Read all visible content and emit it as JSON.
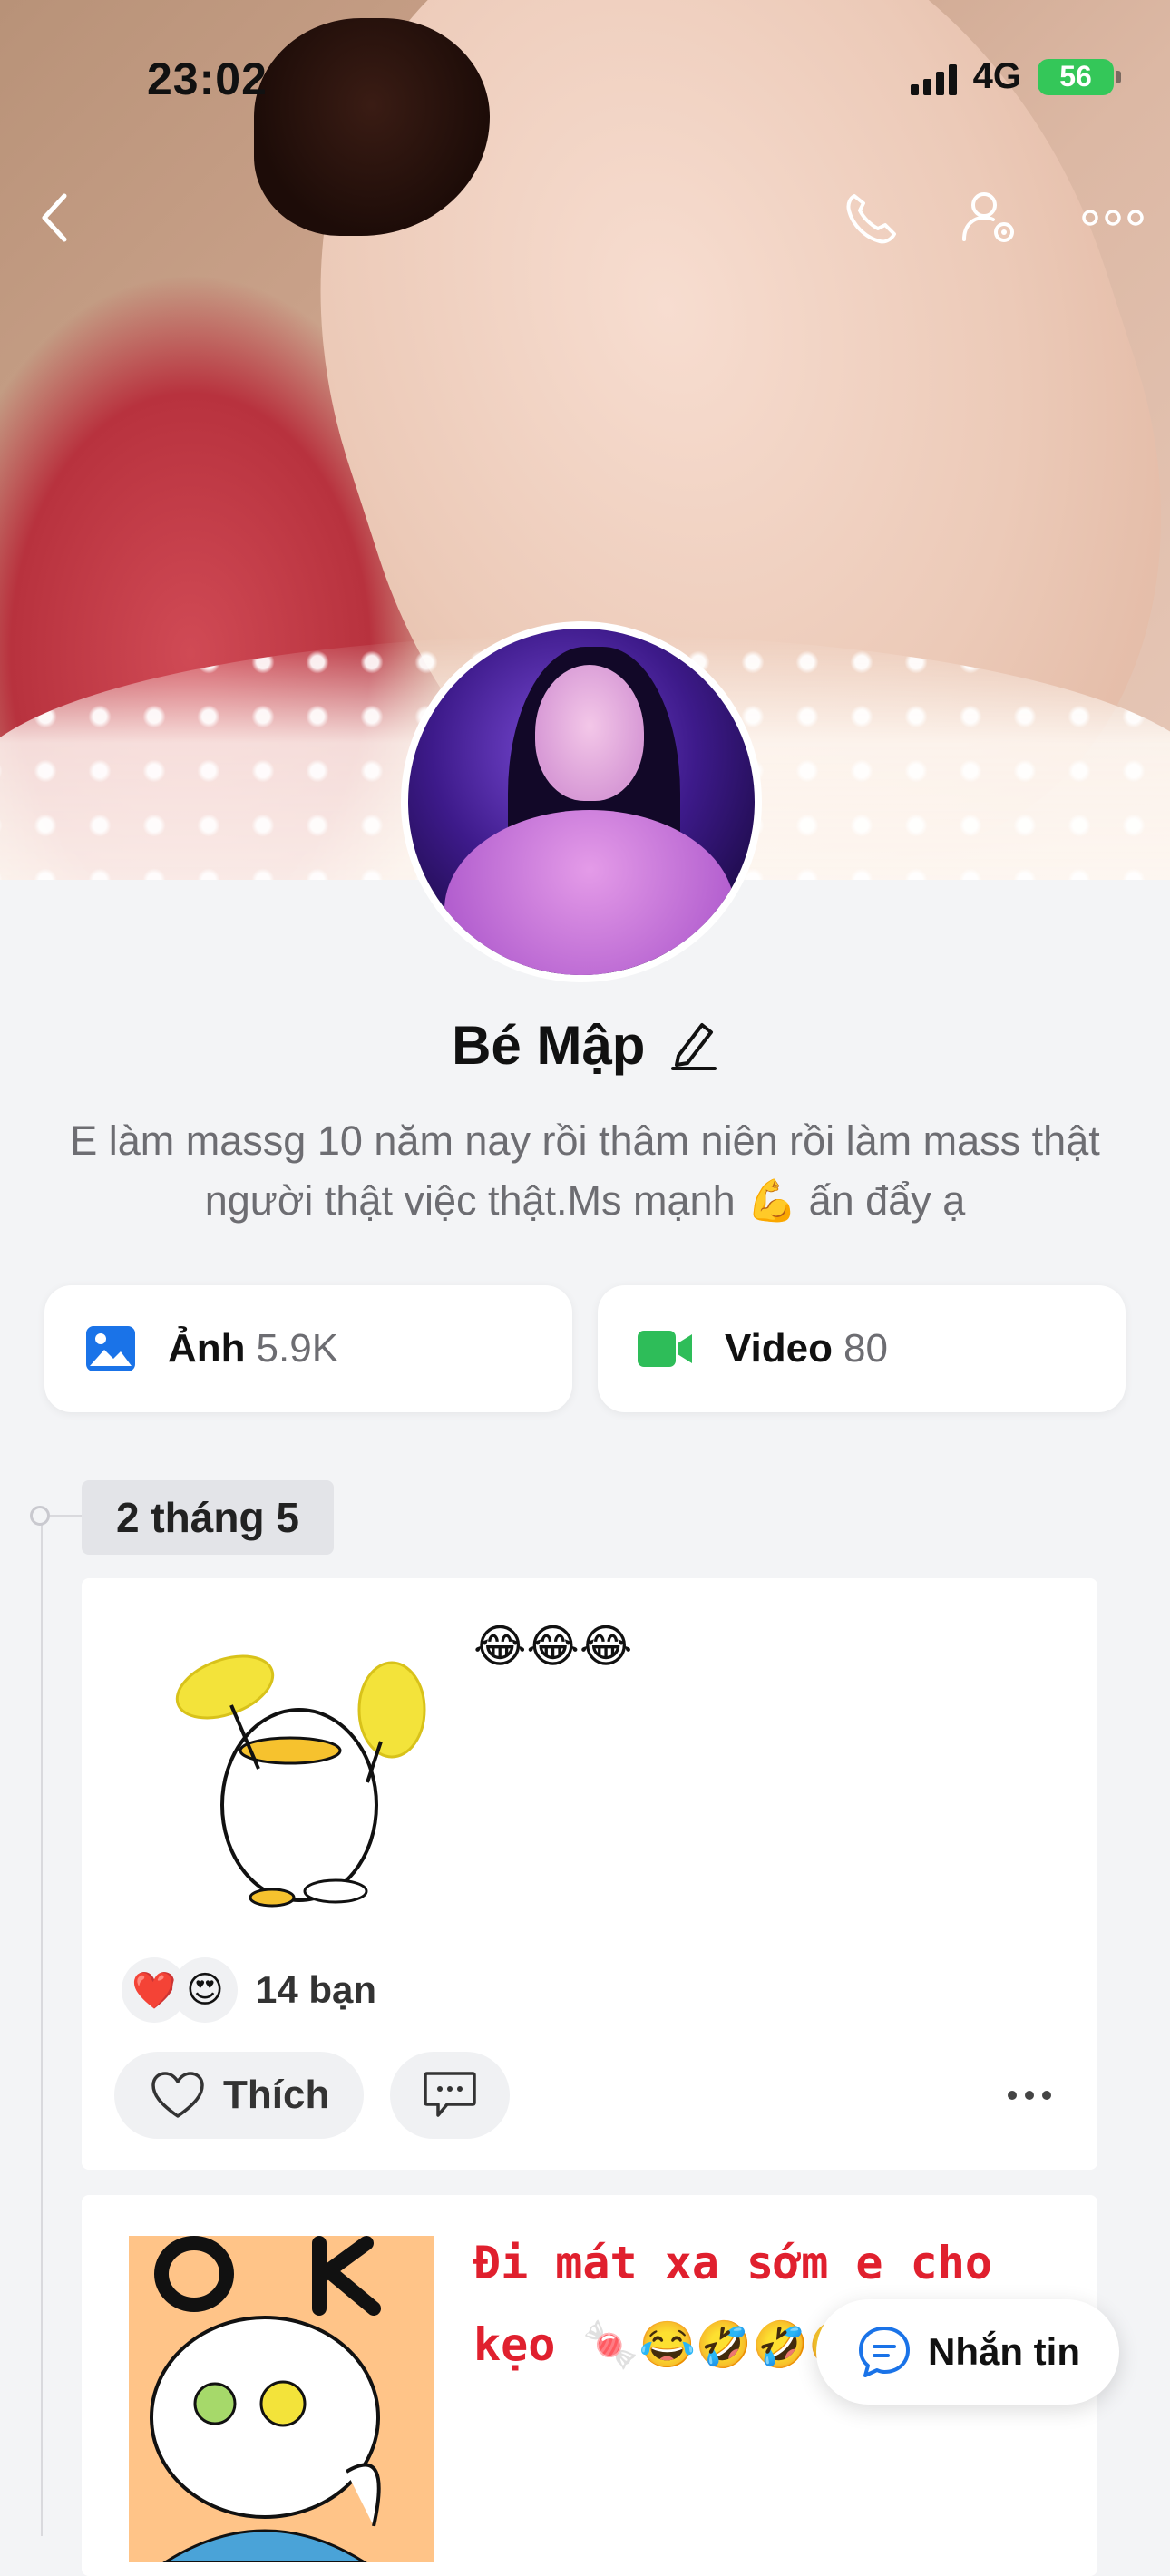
{
  "status_bar": {
    "time": "23:02",
    "network": "4G",
    "battery": "56"
  },
  "nav": {
    "icons": [
      "back-icon",
      "phone-icon",
      "user-settings-icon",
      "more-icon"
    ]
  },
  "profile": {
    "name": "Bé Mập",
    "bio": "E làm massg 10 năm nay rồi thâm niên rồi làm mass thật người thật việc thật.Ms mạnh 💪 ấn đẩy ạ"
  },
  "media": {
    "photos_label": "Ảnh",
    "photos_count": "5.9K",
    "video_label": "Video",
    "video_count": "80"
  },
  "timeline": {
    "date": "2 tháng 5",
    "posts": [
      {
        "text": "😂😂😂",
        "reaction_emojis": [
          "❤️",
          "😍"
        ],
        "reaction_count": "14 bạn",
        "like_label": "Thích"
      },
      {
        "text": "Đi mát xa sớm e cho kẹo 🍬😂🤣🤣🤣"
      }
    ]
  },
  "fab": {
    "label": "Nhắn tin"
  },
  "colors": {
    "photo_icon": "#1a73e8",
    "video_icon": "#2ebd59",
    "battery": "#34c759",
    "post2_text": "#e0202e"
  }
}
